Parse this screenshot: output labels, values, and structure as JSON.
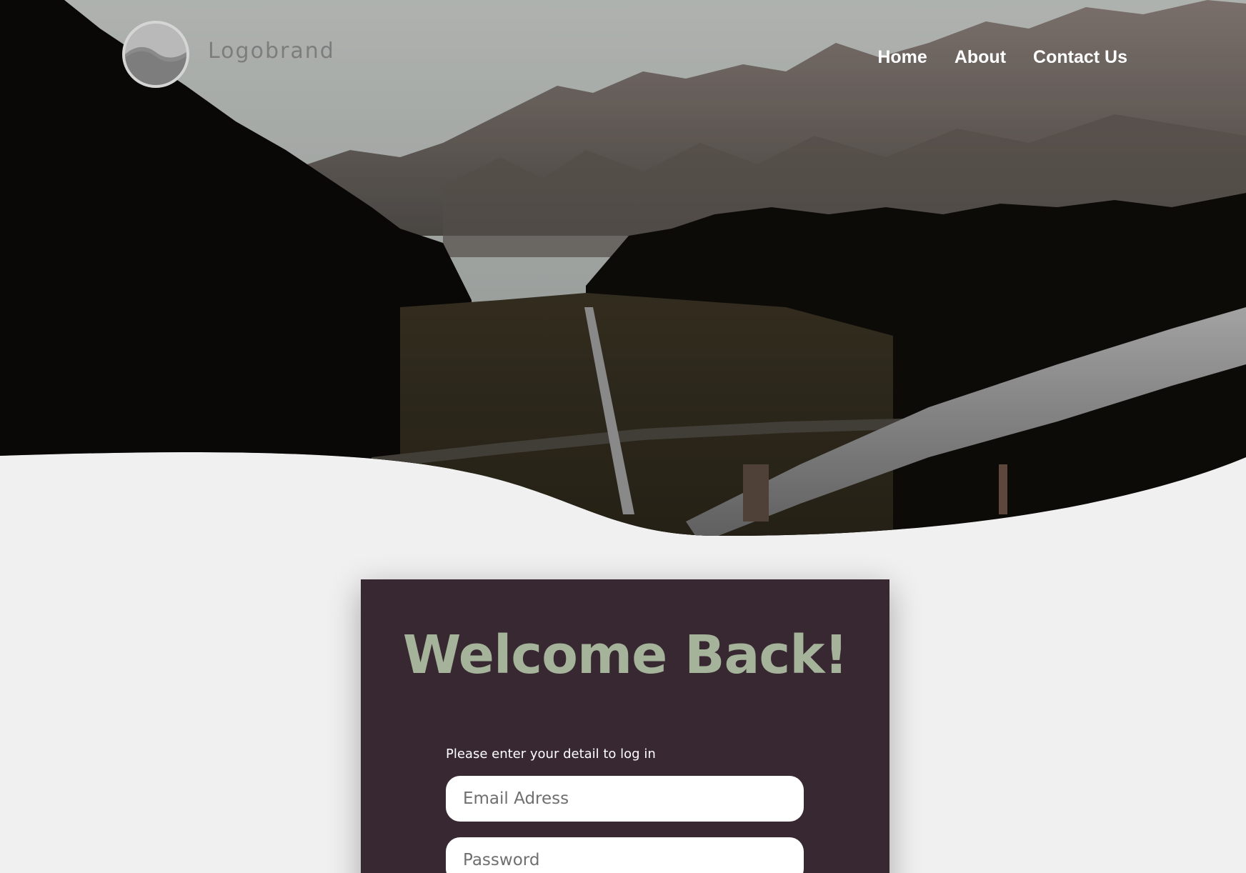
{
  "brand": {
    "name": "Logobrand",
    "logo_icon": "logo-wave-circle"
  },
  "nav": {
    "items": [
      {
        "label": "Home"
      },
      {
        "label": "About"
      },
      {
        "label": "Contact Us"
      }
    ]
  },
  "hero": {
    "image_icon": "mountain-pipeline-photo"
  },
  "login": {
    "title": "Welcome Back!",
    "instructions": "Please enter your detail to log in",
    "email_placeholder": "Email Adress",
    "password_placeholder": "Password"
  },
  "colors": {
    "background": "#f0f0f0",
    "card": "#372831",
    "title": "#a6b39b",
    "nav_text": "#ffffff"
  }
}
